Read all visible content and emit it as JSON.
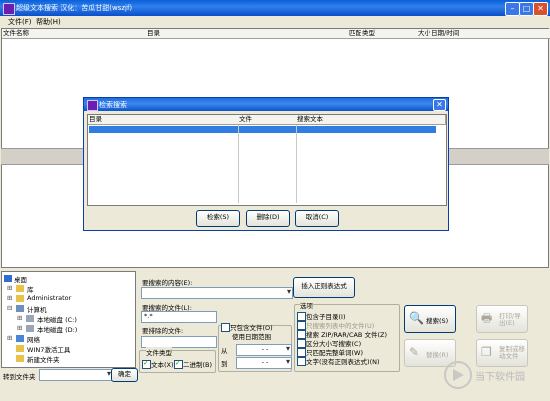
{
  "window": {
    "title": "超级文本搜索  汉化：苦瓜甘甜(wszjf)"
  },
  "menu": {
    "file": "文件(F)",
    "help": "帮助(H)"
  },
  "columns": {
    "filename": "文件名称",
    "dir": "目录",
    "match": "匹配",
    "type": "类型",
    "size": "大小",
    "datetime": "日期/时间"
  },
  "dialog": {
    "title": "检索搜索",
    "columns": {
      "dir": "目录",
      "file": "文件",
      "text": "搜索文本"
    },
    "buttons": {
      "search": "检索(S)",
      "delete": "删除(D)",
      "cancel": "取消(C)"
    }
  },
  "tree": {
    "items": [
      "桌面",
      "库",
      "Administrator",
      "计算机",
      "本地磁盘 (C:)",
      "本地磁盘 (D:)",
      "网络",
      "WIN7激活工具",
      "新建文件夹"
    ]
  },
  "goto": {
    "label": "转到文件夹",
    "ok": "确定"
  },
  "search": {
    "content_label": "要搜索的内容(E):",
    "files_label": "要搜索的文件(L):",
    "files_value": "*.*",
    "exclude_label": "要排除的文件:",
    "regex_button": "插入正则表达式",
    "filetype_label": "文件类型",
    "text_opt": "文本(X)",
    "binary_opt": "二进制(B)",
    "contains_files": "只包含文件(O)",
    "use_date": "使用日期范围",
    "from_label": "从",
    "to_label": "到",
    "date_from": "- -",
    "date_to": "- -"
  },
  "options": {
    "title": "选项",
    "items": [
      "包含子目录(I)",
      "只搜索列表中的文件(U)",
      "搜索 ZIP/RAR/CAB 文件(Z)",
      "区分大小写搜索(C)",
      "只匹配完整单词(W)",
      "文字(没有正则表达式)(N)"
    ],
    "checked": [
      false,
      false,
      false,
      false,
      false,
      false
    ]
  },
  "actions": {
    "search": "搜索(S)",
    "print": "打印/导出(E)",
    "replace": "替换(R)",
    "copy": "复制或移动文件"
  },
  "watermark": {
    "text": "当下软件园"
  }
}
